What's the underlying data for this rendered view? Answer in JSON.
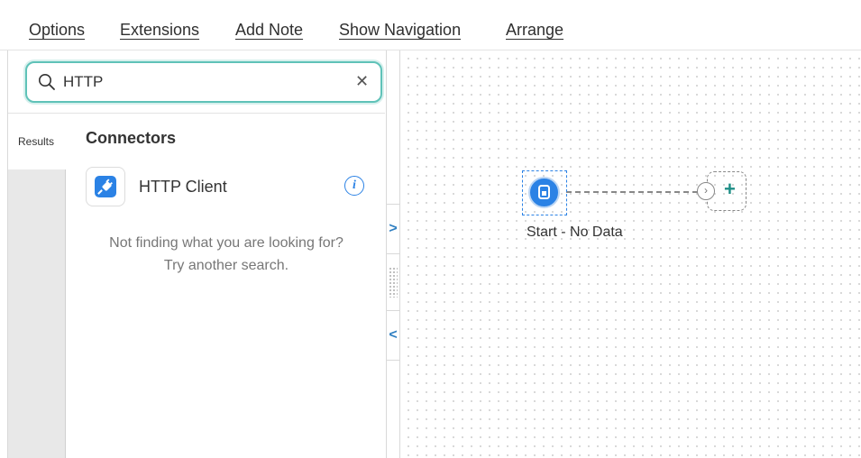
{
  "menu": {
    "items": [
      "Options",
      "Extensions",
      "Add Note",
      "Show Navigation",
      "Arrange"
    ]
  },
  "search": {
    "value": "HTTP",
    "placeholder": "",
    "accent_color": "#5fc2b8"
  },
  "sidebar": {
    "tab_label": "Results"
  },
  "results": {
    "heading": "Connectors",
    "items": [
      {
        "name": "HTTP Client",
        "icon": "plug-icon"
      }
    ],
    "not_finding_line1": "Not finding what you are looking for?",
    "not_finding_line2": "Try another search."
  },
  "canvas": {
    "start_node_label": "Start - No Data",
    "node_color": "#2b82e5",
    "add_color": "#1e8e86"
  },
  "icons": {
    "expand": "chevron-right-icon",
    "collapse": "chevron-left-icon",
    "clear": "close-icon",
    "search": "search-icon",
    "info": "info-icon"
  }
}
